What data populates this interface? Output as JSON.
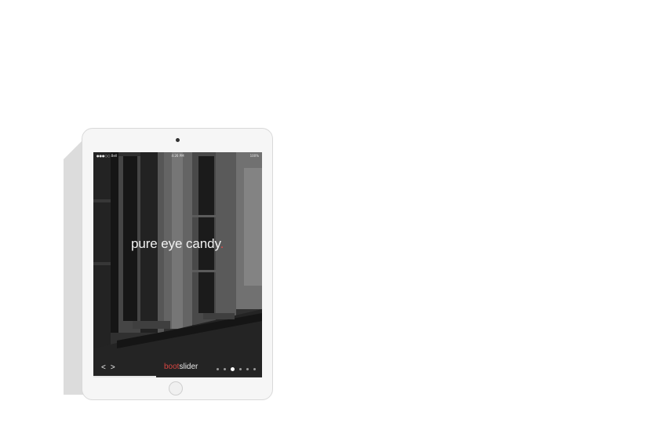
{
  "status_bar": {
    "carrier": "●●●○○ Bell",
    "time": "4:26 PM",
    "battery": "100%"
  },
  "slide": {
    "headline": "pure eye candy",
    "headline_suffix": "."
  },
  "logo": {
    "part1": "boot",
    "part2": "slider"
  },
  "nav": {
    "prev": "<",
    "next": ">"
  },
  "pagination": {
    "count": 6,
    "active_index": 2
  },
  "progress": {
    "fraction": 0.37
  },
  "colors": {
    "accent": "#d64541",
    "device": "#f6f6f6",
    "screen": "#3a3a3a"
  }
}
